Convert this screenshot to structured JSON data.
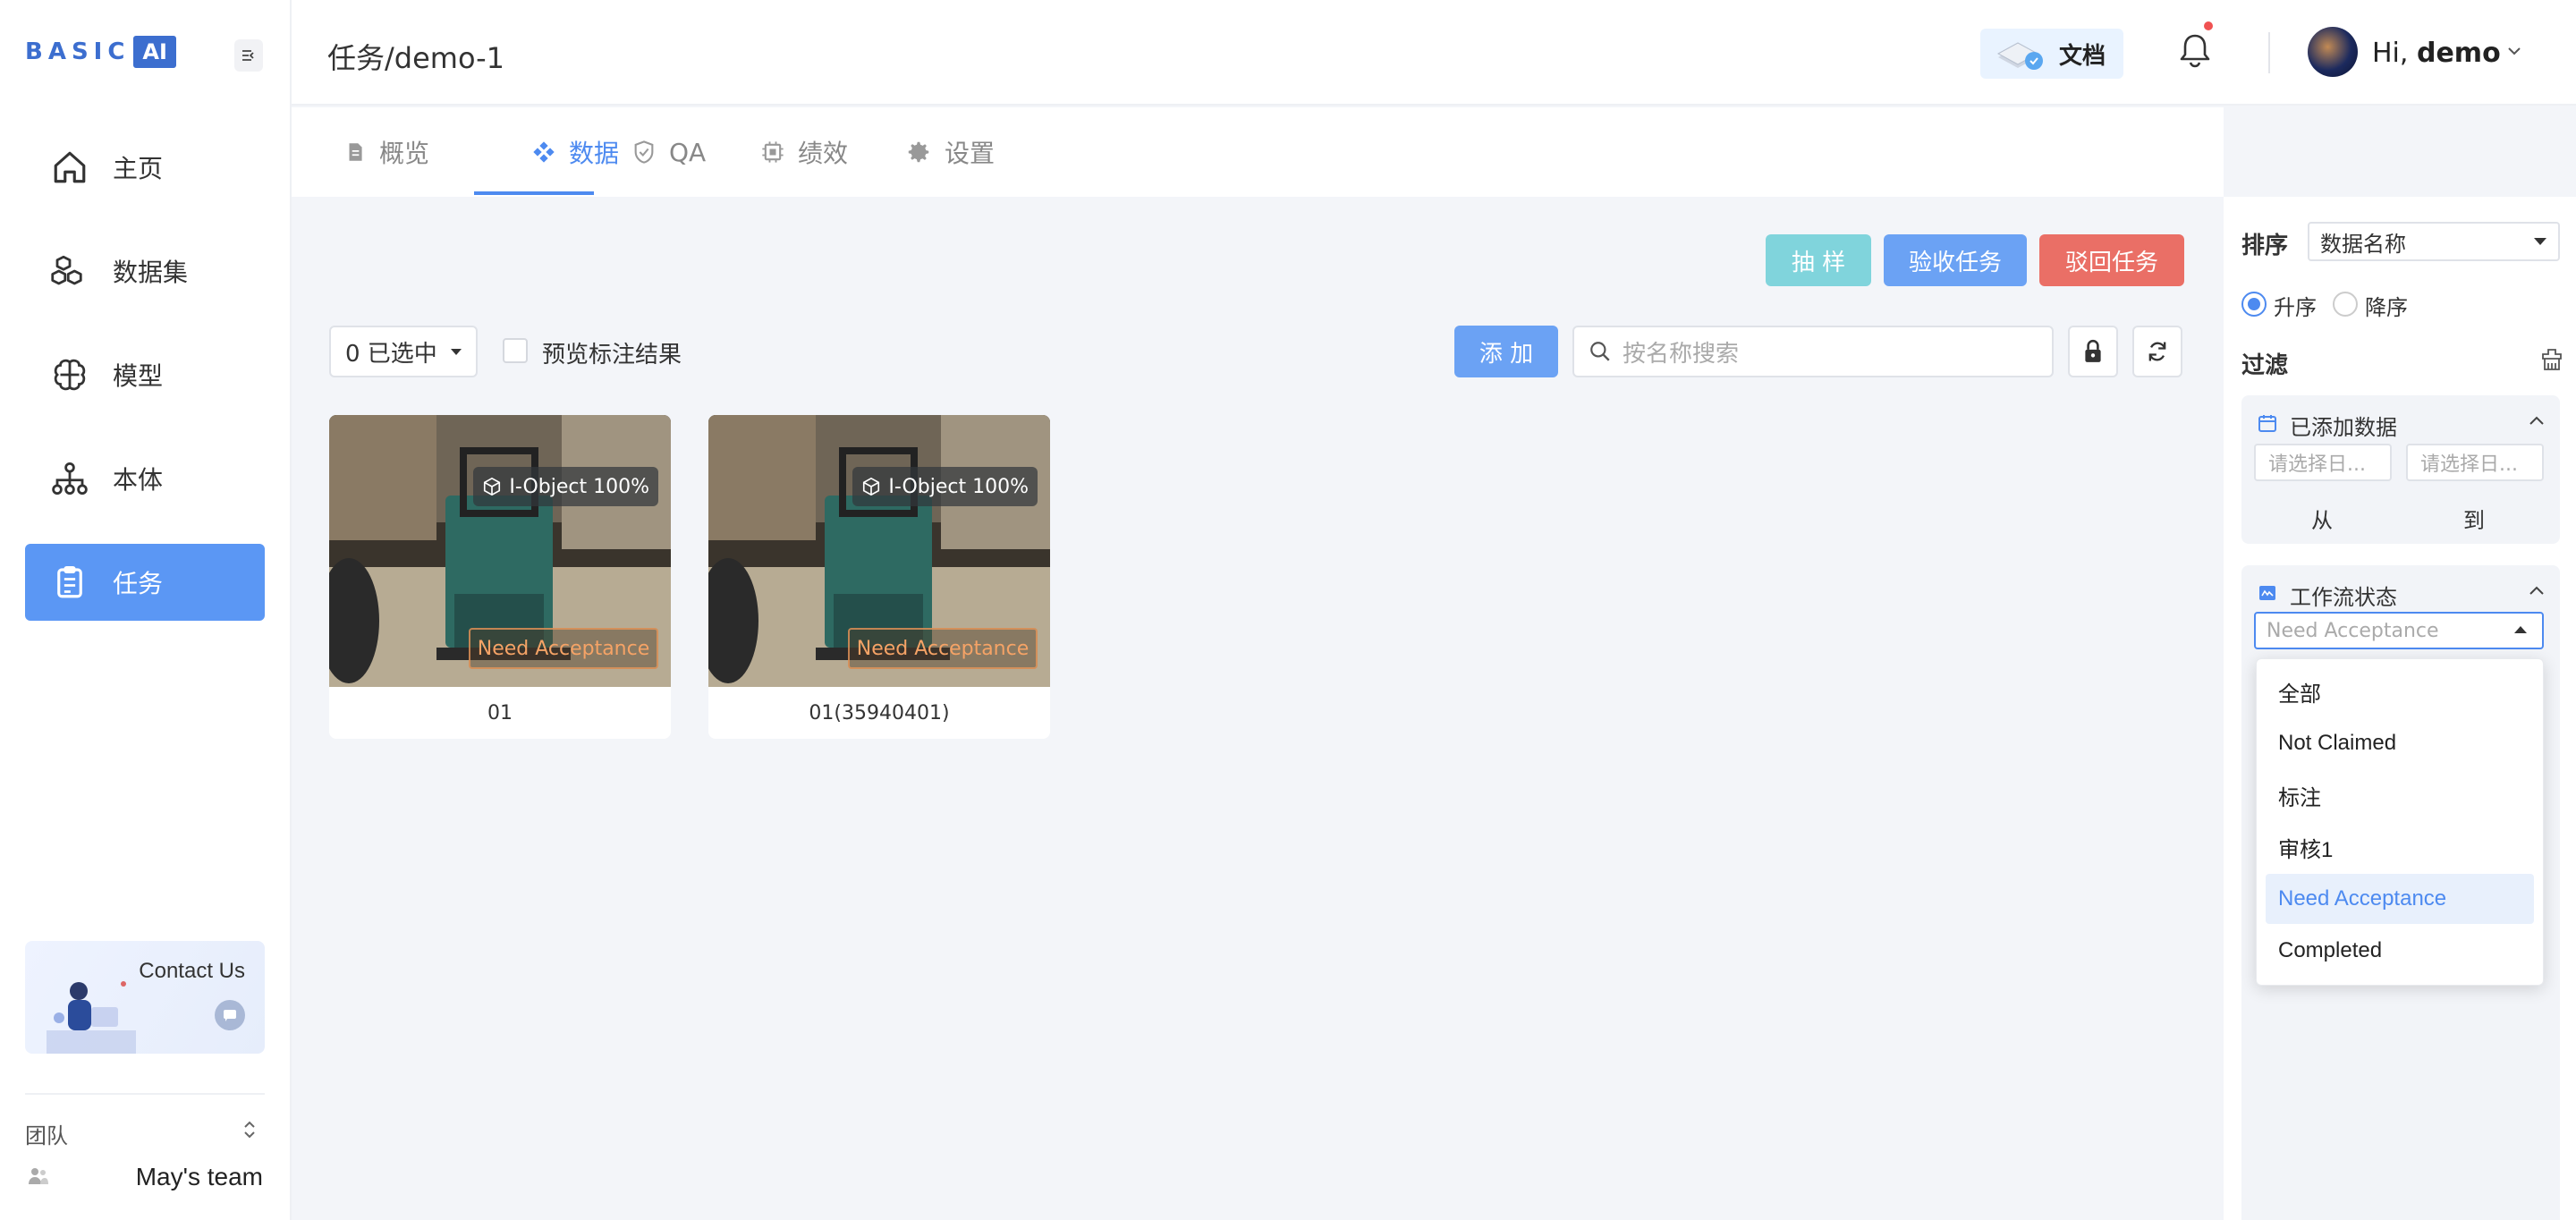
{
  "app": {
    "logo_text": "BASIC",
    "logo_ai": "AI"
  },
  "sidebar": {
    "items": [
      {
        "label": "主页",
        "icon": "home-icon"
      },
      {
        "label": "数据集",
        "icon": "cubes-icon"
      },
      {
        "label": "模型",
        "icon": "brain-icon"
      },
      {
        "label": "本体",
        "icon": "hierarchy-icon"
      },
      {
        "label": "任务",
        "icon": "clipboard-icon",
        "active": true
      }
    ],
    "contact_title": "Contact Us",
    "team_label": "团队",
    "team_name": "May's team"
  },
  "header": {
    "breadcrumb": "任务/demo-1",
    "docs_label": "文档",
    "greeting": "Hi,",
    "username": "demo"
  },
  "tabs": [
    {
      "label": "概览",
      "icon": "document-icon"
    },
    {
      "label": "数据",
      "icon": "diamonds-icon",
      "active": true
    },
    {
      "label": "QA",
      "icon": "shield-check-icon"
    },
    {
      "label": "绩效",
      "icon": "chip-icon"
    },
    {
      "label": "设置",
      "icon": "gear-icon"
    }
  ],
  "toolbar": {
    "sample_label": "抽 样",
    "accept_label": "验收任务",
    "reject_label": "驳回任务",
    "selected_label": "0 已选中",
    "preview_label": "预览标注结果",
    "add_label": "添 加",
    "search_placeholder": "按名称搜索"
  },
  "cards": [
    {
      "name": "01",
      "badge": "I-Object 100%",
      "status": "Need Acceptance"
    },
    {
      "name": "01(35940401)",
      "badge": "I-Object 100%",
      "status": "Need Acceptance"
    }
  ],
  "panel": {
    "sort_label": "排序",
    "sort_value": "数据名称",
    "asc_label": "升序",
    "desc_label": "降序",
    "filter_label": "过滤",
    "added_title": "已添加数据",
    "date_placeholder": "请选择日...",
    "from_label": "从",
    "to_label": "到",
    "workflow_title": "工作流状态",
    "workflow_value": "Need Acceptance",
    "workflow_options": [
      "全部",
      "Not Claimed",
      "标注",
      "审核1",
      "Need Acceptance",
      "Completed"
    ],
    "workflow_selected": "Need Acceptance"
  },
  "colors": {
    "primary": "#5b97f4",
    "sample": "#80d4dc",
    "reject": "#ea6f66",
    "status": "#f5a366"
  }
}
